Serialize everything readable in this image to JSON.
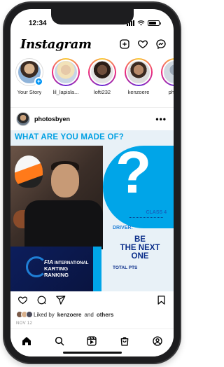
{
  "status_bar": {
    "time": "12:34"
  },
  "app": {
    "logo_text": "Instagram"
  },
  "stories": [
    {
      "name": "Your Story",
      "own": true,
      "color": "#d9b48f"
    },
    {
      "name": "lil_lapisla...",
      "own": false,
      "color": "#e6c9a8"
    },
    {
      "name": "lofti232",
      "own": false,
      "color": "#6f4e3c"
    },
    {
      "name": "kenzoere",
      "own": false,
      "color": "#b88a6a"
    },
    {
      "name": "photo",
      "own": false,
      "color": "#9aa7b5"
    }
  ],
  "post": {
    "username": "photosbyen",
    "more_label": "•••",
    "image": {
      "headline": "WHAT ARE YOU MADE OF?",
      "question_mark": "?",
      "class_label": "CLASS 4",
      "driver_label": "DRIVER:",
      "next_one_line1": "BE",
      "next_one_line2": "THE NEXT",
      "next_one_line3": "ONE",
      "total_label": "TOTAL PTS",
      "fia": {
        "mark": "FIA",
        "line1": "INTERNATIONAL",
        "line2": "KARTING",
        "line3": "RANKING"
      }
    },
    "likes_prefix": "Liked by",
    "likes_user": "kenzoere",
    "likes_and": "and",
    "likes_others": "others",
    "date": "NOV 12"
  },
  "colors": {
    "accent_blue": "#00a5e8",
    "navy": "#0b2e8a",
    "ig_blue": "#0095f6"
  }
}
